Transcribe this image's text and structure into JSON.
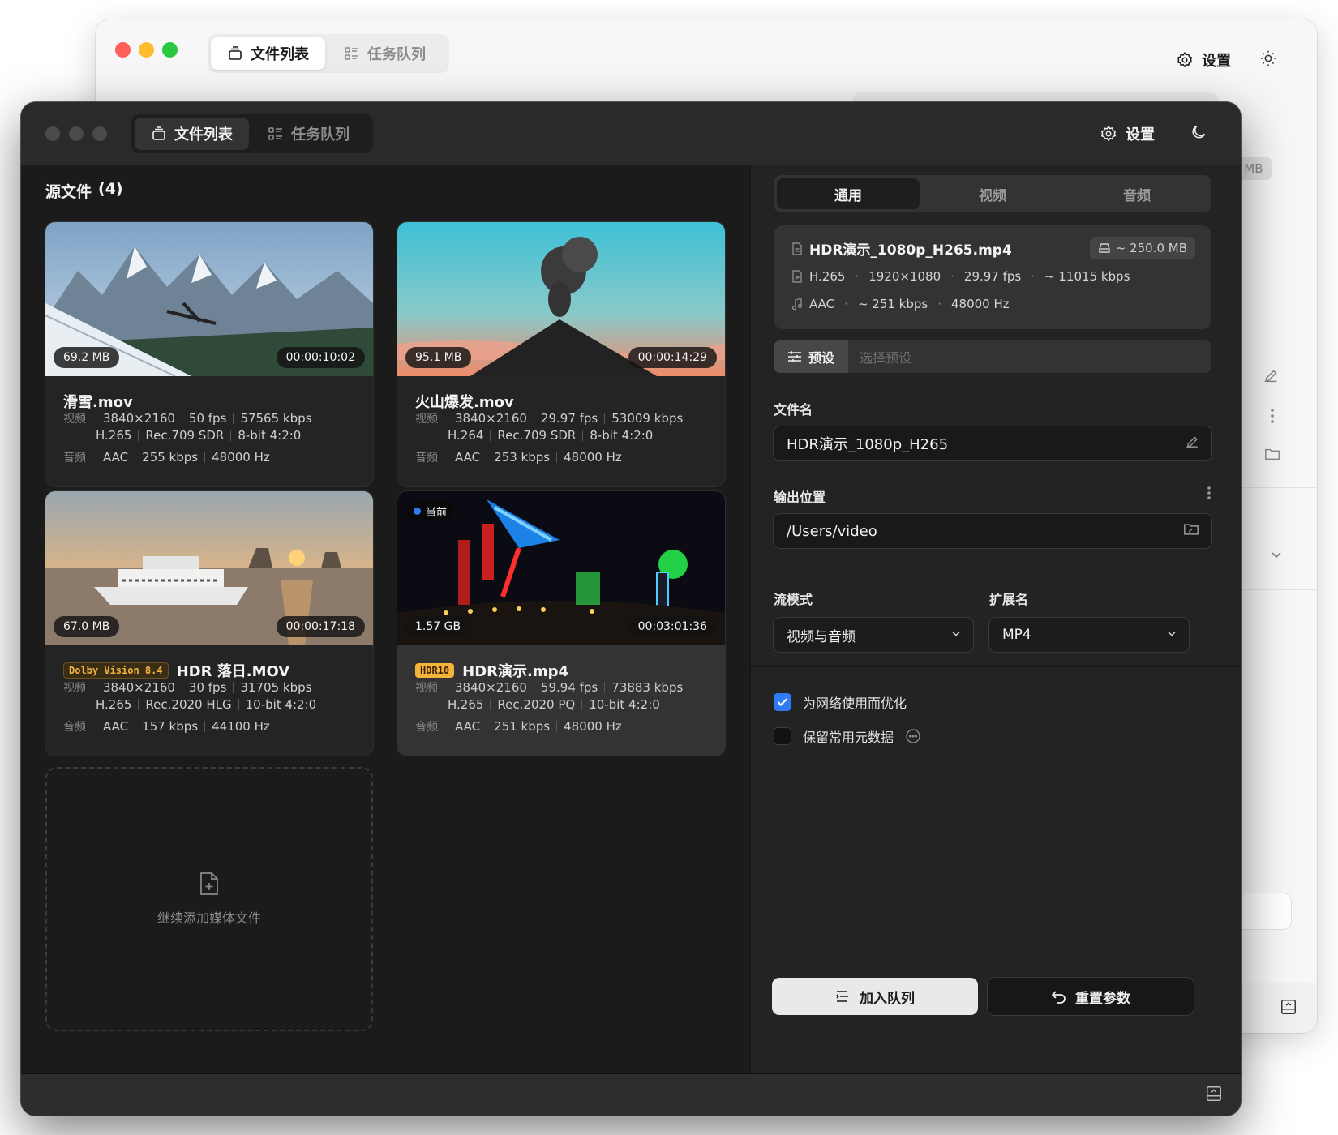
{
  "colors": {
    "accent_blue": "#2f7bf6",
    "traffic_close": "#fe5f57",
    "traffic_min": "#febc2e",
    "traffic_max": "#28c840",
    "hdr_gold": "#f4b33a"
  },
  "back_window": {
    "tabs": [
      {
        "label": "文件列表",
        "icon": "file-stack-icon"
      },
      {
        "label": "任务队列",
        "icon": "queue-list-icon"
      }
    ],
    "settings_label": "设置",
    "size_fragment": "0 MB"
  },
  "window": {
    "tabs": [
      {
        "label": "文件列表",
        "icon": "file-stack-icon"
      },
      {
        "label": "任务队列",
        "icon": "queue-list-icon"
      }
    ],
    "settings_label": "设置"
  },
  "source": {
    "title": "源文件",
    "count": "(4)"
  },
  "files": [
    {
      "name": "滑雪.mov",
      "size": "69.2 MB",
      "duration": "00:00:10:02",
      "badge": "",
      "video_label": "视频",
      "audio_label": "音频",
      "video_line1": [
        "3840×2160",
        "50 fps",
        "57565 kbps"
      ],
      "video_line2": [
        "H.265",
        "Rec.709 SDR",
        "8-bit 4:2:0"
      ],
      "audio_line": [
        "AAC",
        "255 kbps",
        "48000 Hz"
      ]
    },
    {
      "name": "火山爆发.mov",
      "size": "95.1 MB",
      "duration": "00:00:14:29",
      "badge": "",
      "video_label": "视频",
      "audio_label": "音频",
      "video_line1": [
        "3840×2160",
        "29.97 fps",
        "53009 kbps"
      ],
      "video_line2": [
        "H.264",
        "Rec.709 SDR",
        "8-bit 4:2:0"
      ],
      "audio_line": [
        "AAC",
        "253 kbps",
        "48000 Hz"
      ]
    },
    {
      "name": "HDR 落日.MOV",
      "size": "67.0 MB",
      "duration": "00:00:17:18",
      "badge": "Dolby Vision 8.4",
      "video_label": "视频",
      "audio_label": "音频",
      "video_line1": [
        "3840×2160",
        "30 fps",
        "31705 kbps"
      ],
      "video_line2": [
        "H.265",
        "Rec.2020 HLG",
        "10-bit 4:2:0"
      ],
      "audio_line": [
        "AAC",
        "157 kbps",
        "44100 Hz"
      ]
    },
    {
      "name": "HDR演示.mp4",
      "size": "1.57 GB",
      "duration": "00:03:01:36",
      "badge": "HDR10",
      "current_label": "当前",
      "video_label": "视频",
      "audio_label": "音频",
      "video_line1": [
        "3840×2160",
        "59.94 fps",
        "73883 kbps"
      ],
      "video_line2": [
        "H.265",
        "Rec.2020 PQ",
        "10-bit 4:2:0"
      ],
      "audio_line": [
        "AAC",
        "251 kbps",
        "48000 Hz"
      ]
    }
  ],
  "add_more_label": "继续添加媒体文件",
  "panel": {
    "tabs": [
      "通用",
      "视频",
      "音频"
    ],
    "info": {
      "filename": "HDR演示_1080p_H265.mp4",
      "estimated_size": "~ 250.0 MB",
      "video": [
        "H.265",
        "1920×1080",
        "29.97 fps",
        "~ 11015 kbps"
      ],
      "audio": [
        "AAC",
        "~ 251 kbps",
        "48000 Hz"
      ]
    },
    "preset_label": "预设",
    "preset_placeholder": "选择预设",
    "filename_label": "文件名",
    "filename_value": "HDR演示_1080p_H265",
    "output_label": "输出位置",
    "output_value": "/Users/video",
    "stream_label": "流模式",
    "stream_value": "视频与音频",
    "ext_label": "扩展名",
    "ext_value": "MP4",
    "optimize_label": "为网络使用而优化",
    "optimize_checked": true,
    "keep_meta_label": "保留常用元数据",
    "keep_meta_checked": false,
    "enqueue_label": "加入队列",
    "reset_label": "重置参数"
  }
}
